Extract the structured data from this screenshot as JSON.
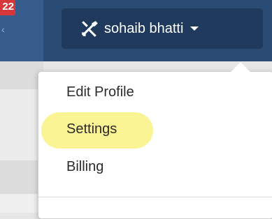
{
  "header": {
    "notification_count": "22",
    "user_menu": {
      "name": "sohaib bhatti",
      "icon": "wrench-screwdriver-icon",
      "dropdown_icon": "caret-down-icon"
    }
  },
  "dropdown": {
    "items": [
      {
        "label": "Edit Profile"
      },
      {
        "label": "Settings",
        "highlighted": true
      },
      {
        "label": "Billing"
      }
    ]
  },
  "colors": {
    "topbar": "#2a4b74",
    "user_button": "#1f3a5c",
    "badge": "#d8373a",
    "highlight": "#fbf38a"
  }
}
